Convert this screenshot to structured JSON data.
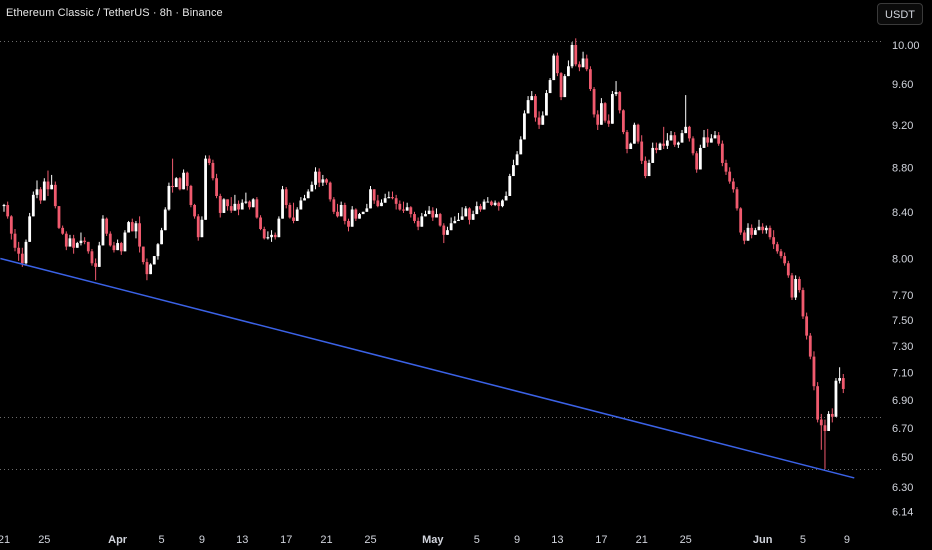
{
  "header": {
    "title": "Ethereum Classic / TetherUS · 8h · Binance",
    "currency_label": "USDT"
  },
  "colors": {
    "background": "#000000",
    "up": "#ffffff",
    "down": "#f05a6e",
    "trendline": "#3b62e6",
    "dotted_line": "#6b6b6b",
    "text": "#d1d4dc"
  },
  "chart_data": {
    "type": "candlestick",
    "y_scale": "log",
    "ylim": [
      6.08,
      10.1
    ],
    "y_ticks": [
      "10.00",
      "9.60",
      "9.20",
      "8.80",
      "8.40",
      "8.00",
      "7.70",
      "7.50",
      "7.30",
      "7.10",
      "6.90",
      "6.70",
      "6.50",
      "6.30",
      "6.14"
    ],
    "x_ticks": [
      {
        "label": "21",
        "idx": 0
      },
      {
        "label": "25",
        "idx": 11
      },
      {
        "label": "Apr",
        "idx": 31,
        "bold": true
      },
      {
        "label": "5",
        "idx": 43
      },
      {
        "label": "9",
        "idx": 54
      },
      {
        "label": "13",
        "idx": 65
      },
      {
        "label": "17",
        "idx": 77
      },
      {
        "label": "21",
        "idx": 88
      },
      {
        "label": "25",
        "idx": 100
      },
      {
        "label": "May",
        "idx": 117,
        "bold": true
      },
      {
        "label": "5",
        "idx": 129
      },
      {
        "label": "9",
        "idx": 140
      },
      {
        "label": "13",
        "idx": 151
      },
      {
        "label": "17",
        "idx": 163
      },
      {
        "label": "21",
        "idx": 174
      },
      {
        "label": "25",
        "idx": 186
      },
      {
        "label": "Jun",
        "idx": 207,
        "bold": true
      },
      {
        "label": "5",
        "idx": 218
      },
      {
        "label": "9",
        "idx": 230
      }
    ],
    "horizontal_levels": [
      10.04,
      6.78,
      6.42
    ],
    "trendline": {
      "start": [
        -1,
        8.0
      ],
      "end": [
        232,
        6.36
      ]
    },
    "candles": [
      [
        8.45,
        8.4,
        8.47,
        8.46
      ],
      [
        8.46,
        8.34,
        8.49,
        8.36
      ],
      [
        8.36,
        8.16,
        8.37,
        8.21
      ],
      [
        8.21,
        8.06,
        8.25,
        8.09
      ],
      [
        8.09,
        7.98,
        8.14,
        8.04
      ],
      [
        8.04,
        7.93,
        8.09,
        7.96
      ],
      [
        7.96,
        7.94,
        8.16,
        8.14
      ],
      [
        8.14,
        8.14,
        8.39,
        8.36
      ],
      [
        8.36,
        8.36,
        8.58,
        8.55
      ],
      [
        8.55,
        8.52,
        8.68,
        8.6
      ],
      [
        8.6,
        8.47,
        8.62,
        8.5
      ],
      [
        8.5,
        8.5,
        8.7,
        8.67
      ],
      [
        8.67,
        8.54,
        8.77,
        8.6
      ],
      [
        8.6,
        8.6,
        8.73,
        8.64
      ],
      [
        8.64,
        8.43,
        8.67,
        8.45
      ],
      [
        8.45,
        8.25,
        8.45,
        8.26
      ],
      [
        8.26,
        8.2,
        8.28,
        8.21
      ],
      [
        8.21,
        8.07,
        8.23,
        8.1
      ],
      [
        8.1,
        8.1,
        8.2,
        8.17
      ],
      [
        8.17,
        8.04,
        8.2,
        8.09
      ],
      [
        8.09,
        8.09,
        8.14,
        8.13
      ],
      [
        8.13,
        8.11,
        8.22,
        8.15
      ],
      [
        8.15,
        8.12,
        8.18,
        8.14
      ],
      [
        8.14,
        8.04,
        8.14,
        8.06
      ],
      [
        8.06,
        7.94,
        8.08,
        7.96
      ],
      [
        7.96,
        7.82,
        8.0,
        7.93
      ],
      [
        7.93,
        7.93,
        8.14,
        8.11
      ],
      [
        8.11,
        8.11,
        8.37,
        8.34
      ],
      [
        8.34,
        8.19,
        8.35,
        8.21
      ],
      [
        8.21,
        8.1,
        8.23,
        8.11
      ],
      [
        8.11,
        8.05,
        8.14,
        8.07
      ],
      [
        8.07,
        8.07,
        8.16,
        8.13
      ],
      [
        8.13,
        8.03,
        8.14,
        8.06
      ],
      [
        8.06,
        8.06,
        8.24,
        8.22
      ],
      [
        8.22,
        8.22,
        8.32,
        8.31
      ],
      [
        8.31,
        8.23,
        8.34,
        8.23
      ],
      [
        8.23,
        8.17,
        8.32,
        8.3
      ],
      [
        8.3,
        8.05,
        8.36,
        8.1
      ],
      [
        8.1,
        7.95,
        8.1,
        7.97
      ],
      [
        7.97,
        7.82,
        8.0,
        7.87
      ],
      [
        7.87,
        7.87,
        7.96,
        7.95
      ],
      [
        7.95,
        7.95,
        8.02,
        8.02
      ],
      [
        8.02,
        7.99,
        8.13,
        8.12
      ],
      [
        8.12,
        8.12,
        8.26,
        8.24
      ],
      [
        8.24,
        8.24,
        8.44,
        8.42
      ],
      [
        8.42,
        8.41,
        8.66,
        8.63
      ],
      [
        8.63,
        8.57,
        8.88,
        8.62
      ],
      [
        8.62,
        8.62,
        8.71,
        8.7
      ],
      [
        8.7,
        8.59,
        8.71,
        8.6
      ],
      [
        8.6,
        8.6,
        8.78,
        8.75
      ],
      [
        8.75,
        8.59,
        8.76,
        8.63
      ],
      [
        8.63,
        8.44,
        8.64,
        8.46
      ],
      [
        8.46,
        8.34,
        8.47,
        8.36
      ],
      [
        8.36,
        8.15,
        8.38,
        8.18
      ],
      [
        8.18,
        8.18,
        8.36,
        8.33
      ],
      [
        8.33,
        8.33,
        8.91,
        8.88
      ],
      [
        8.88,
        8.82,
        8.91,
        8.84
      ],
      [
        8.84,
        8.68,
        8.87,
        8.7
      ],
      [
        8.7,
        8.52,
        8.74,
        8.54
      ],
      [
        8.54,
        8.35,
        8.56,
        8.39
      ],
      [
        8.39,
        8.39,
        8.52,
        8.51
      ],
      [
        8.51,
        8.41,
        8.51,
        8.45
      ],
      [
        8.45,
        8.39,
        8.53,
        8.41
      ],
      [
        8.41,
        8.41,
        8.55,
        8.47
      ],
      [
        8.47,
        8.37,
        8.5,
        8.42
      ],
      [
        8.42,
        8.42,
        8.51,
        8.48
      ],
      [
        8.48,
        8.47,
        8.57,
        8.49
      ],
      [
        8.49,
        8.42,
        8.5,
        8.44
      ],
      [
        8.44,
        8.44,
        8.52,
        8.51
      ],
      [
        8.51,
        8.34,
        8.53,
        8.35
      ],
      [
        8.35,
        8.24,
        8.37,
        8.25
      ],
      [
        8.25,
        8.16,
        8.27,
        8.17
      ],
      [
        8.17,
        8.16,
        8.23,
        8.18
      ],
      [
        8.18,
        8.14,
        8.24,
        8.2
      ],
      [
        8.2,
        8.16,
        8.22,
        8.18
      ],
      [
        8.18,
        8.18,
        8.36,
        8.34
      ],
      [
        8.34,
        8.34,
        8.63,
        8.6
      ],
      [
        8.6,
        8.43,
        8.62,
        8.46
      ],
      [
        8.46,
        8.34,
        8.48,
        8.35
      ],
      [
        8.35,
        8.3,
        8.48,
        8.32
      ],
      [
        8.32,
        8.32,
        8.44,
        8.42
      ],
      [
        8.42,
        8.42,
        8.53,
        8.5
      ],
      [
        8.5,
        8.5,
        8.55,
        8.52
      ],
      [
        8.52,
        8.52,
        8.6,
        8.58
      ],
      [
        8.58,
        8.58,
        8.67,
        8.64
      ],
      [
        8.64,
        8.6,
        8.8,
        8.76
      ],
      [
        8.76,
        8.62,
        8.79,
        8.66
      ],
      [
        8.66,
        8.63,
        8.73,
        8.69
      ],
      [
        8.69,
        8.64,
        8.7,
        8.66
      ],
      [
        8.66,
        8.49,
        8.67,
        8.51
      ],
      [
        8.51,
        8.38,
        8.53,
        8.4
      ],
      [
        8.4,
        8.35,
        8.47,
        8.36
      ],
      [
        8.36,
        8.36,
        8.49,
        8.46
      ],
      [
        8.46,
        8.29,
        8.48,
        8.32
      ],
      [
        8.32,
        8.23,
        8.34,
        8.27
      ],
      [
        8.27,
        8.27,
        8.45,
        8.42
      ],
      [
        8.42,
        8.32,
        8.43,
        8.34
      ],
      [
        8.34,
        8.34,
        8.39,
        8.38
      ],
      [
        8.38,
        8.38,
        8.4,
        8.4
      ],
      [
        8.4,
        8.4,
        8.47,
        8.43
      ],
      [
        8.43,
        8.43,
        8.63,
        8.6
      ],
      [
        8.6,
        8.47,
        8.6,
        8.5
      ],
      [
        8.5,
        8.44,
        8.55,
        8.45
      ],
      [
        8.45,
        8.45,
        8.51,
        8.48
      ],
      [
        8.48,
        8.48,
        8.56,
        8.52
      ],
      [
        8.52,
        8.52,
        8.58,
        8.53
      ],
      [
        8.53,
        8.51,
        8.58,
        8.52
      ],
      [
        8.52,
        8.42,
        8.55,
        8.47
      ],
      [
        8.47,
        8.41,
        8.5,
        8.42
      ],
      [
        8.42,
        8.39,
        8.49,
        8.41
      ],
      [
        8.41,
        8.41,
        8.48,
        8.44
      ],
      [
        8.44,
        8.35,
        8.45,
        8.38
      ],
      [
        8.38,
        8.3,
        8.4,
        8.32
      ],
      [
        8.32,
        8.24,
        8.35,
        8.27
      ],
      [
        8.27,
        8.27,
        8.39,
        8.36
      ],
      [
        8.36,
        8.36,
        8.41,
        8.38
      ],
      [
        8.38,
        8.38,
        8.45,
        8.41
      ],
      [
        8.41,
        8.32,
        8.44,
        8.35
      ],
      [
        8.35,
        8.35,
        8.43,
        8.38
      ],
      [
        8.38,
        8.27,
        8.39,
        8.28
      ],
      [
        8.28,
        8.13,
        8.3,
        8.2
      ],
      [
        8.2,
        8.2,
        8.27,
        8.24
      ],
      [
        8.24,
        8.24,
        8.35,
        8.3
      ],
      [
        8.3,
        8.3,
        8.36,
        8.32
      ],
      [
        8.32,
        8.32,
        8.39,
        8.33
      ],
      [
        8.33,
        8.33,
        8.44,
        8.36
      ],
      [
        8.36,
        8.36,
        8.45,
        8.43
      ],
      [
        8.43,
        8.29,
        8.44,
        8.33
      ],
      [
        8.33,
        8.33,
        8.41,
        8.38
      ],
      [
        8.38,
        8.38,
        8.49,
        8.45
      ],
      [
        8.45,
        8.4,
        8.47,
        8.42
      ],
      [
        8.42,
        8.42,
        8.51,
        8.49
      ],
      [
        8.49,
        8.49,
        8.53,
        8.49
      ],
      [
        8.49,
        8.45,
        8.5,
        8.46
      ],
      [
        8.46,
        8.45,
        8.5,
        8.48
      ],
      [
        8.48,
        8.41,
        8.49,
        8.45
      ],
      [
        8.45,
        8.44,
        8.51,
        8.5
      ],
      [
        8.5,
        8.5,
        8.58,
        8.54
      ],
      [
        8.54,
        8.54,
        8.74,
        8.72
      ],
      [
        8.72,
        8.72,
        8.87,
        8.82
      ],
      [
        8.82,
        8.82,
        8.95,
        8.92
      ],
      [
        8.92,
        8.92,
        9.09,
        9.06
      ],
      [
        9.06,
        9.06,
        9.34,
        9.31
      ],
      [
        9.31,
        9.31,
        9.48,
        9.44
      ],
      [
        9.44,
        9.44,
        9.53,
        9.48
      ],
      [
        9.48,
        9.23,
        9.5,
        9.27
      ],
      [
        9.27,
        9.16,
        9.33,
        9.2
      ],
      [
        9.2,
        9.2,
        9.33,
        9.29
      ],
      [
        9.29,
        9.29,
        9.54,
        9.51
      ],
      [
        9.51,
        9.51,
        9.66,
        9.64
      ],
      [
        9.64,
        9.64,
        9.91,
        9.89
      ],
      [
        9.89,
        9.68,
        9.92,
        9.71
      ],
      [
        9.71,
        9.44,
        9.72,
        9.47
      ],
      [
        9.47,
        9.47,
        9.7,
        9.68
      ],
      [
        9.68,
        9.68,
        9.84,
        9.78
      ],
      [
        9.78,
        9.76,
        10.03,
        10.0
      ],
      [
        10.0,
        9.78,
        10.07,
        9.8
      ],
      [
        9.8,
        9.73,
        9.83,
        9.77
      ],
      [
        9.77,
        9.77,
        9.93,
        9.86
      ],
      [
        9.86,
        9.73,
        9.9,
        9.75
      ],
      [
        9.75,
        9.53,
        9.78,
        9.55
      ],
      [
        9.55,
        9.27,
        9.57,
        9.3
      ],
      [
        9.3,
        9.15,
        9.34,
        9.2
      ],
      [
        9.2,
        9.2,
        9.46,
        9.41
      ],
      [
        9.41,
        9.22,
        9.42,
        9.24
      ],
      [
        9.24,
        9.18,
        9.3,
        9.21
      ],
      [
        9.21,
        9.21,
        9.53,
        9.5
      ],
      [
        9.5,
        9.48,
        9.63,
        9.52
      ],
      [
        9.52,
        9.31,
        9.53,
        9.34
      ],
      [
        9.34,
        9.11,
        9.35,
        9.13
      ],
      [
        9.13,
        8.93,
        9.15,
        8.97
      ],
      [
        8.97,
        8.97,
        9.03,
        9.02
      ],
      [
        9.02,
        9.02,
        9.22,
        9.2
      ],
      [
        9.2,
        9.02,
        9.21,
        9.04
      ],
      [
        9.04,
        8.83,
        9.1,
        8.86
      ],
      [
        8.86,
        8.7,
        8.9,
        8.72
      ],
      [
        8.72,
        8.72,
        8.87,
        8.84
      ],
      [
        8.84,
        8.84,
        9.03,
        8.98
      ],
      [
        8.98,
        8.93,
        9.03,
        8.96
      ],
      [
        8.96,
        8.96,
        9.03,
        9.02
      ],
      [
        9.02,
        8.97,
        9.18,
        9.0
      ],
      [
        9.0,
        8.97,
        9.12,
        9.05
      ],
      [
        9.05,
        9.05,
        9.14,
        9.1
      ],
      [
        9.1,
        8.99,
        9.13,
        9.01
      ],
      [
        9.01,
        8.98,
        9.04,
        9.03
      ],
      [
        9.03,
        9.03,
        9.15,
        9.12
      ],
      [
        9.12,
        9.12,
        9.49,
        9.18
      ],
      [
        9.18,
        9.04,
        9.19,
        9.07
      ],
      [
        9.07,
        8.91,
        9.09,
        8.93
      ],
      [
        8.93,
        8.75,
        8.95,
        8.78
      ],
      [
        8.78,
        8.78,
        9.01,
        8.98
      ],
      [
        8.98,
        8.98,
        9.15,
        9.08
      ],
      [
        9.08,
        8.99,
        9.16,
        9.03
      ],
      [
        9.03,
        9.03,
        9.11,
        9.07
      ],
      [
        9.07,
        9.07,
        9.14,
        9.1
      ],
      [
        9.1,
        9.0,
        9.13,
        9.02
      ],
      [
        9.02,
        8.81,
        9.05,
        8.84
      ],
      [
        8.84,
        8.73,
        8.87,
        8.76
      ],
      [
        8.76,
        8.65,
        8.8,
        8.67
      ],
      [
        8.67,
        8.57,
        8.7,
        8.6
      ],
      [
        8.6,
        8.41,
        8.62,
        8.43
      ],
      [
        8.43,
        8.2,
        8.44,
        8.22
      ],
      [
        8.22,
        8.12,
        8.24,
        8.15
      ],
      [
        8.15,
        8.15,
        8.3,
        8.26
      ],
      [
        8.26,
        8.17,
        8.29,
        8.2
      ],
      [
        8.2,
        8.2,
        8.26,
        8.24
      ],
      [
        8.24,
        8.24,
        8.33,
        8.27
      ],
      [
        8.27,
        8.21,
        8.3,
        8.24
      ],
      [
        8.24,
        8.21,
        8.28,
        8.26
      ],
      [
        8.26,
        8.16,
        8.28,
        8.18
      ],
      [
        8.18,
        8.08,
        8.24,
        8.12
      ],
      [
        8.12,
        8.04,
        8.14,
        8.06
      ],
      [
        8.06,
        8.0,
        8.08,
        8.02
      ],
      [
        8.02,
        7.94,
        8.05,
        7.96
      ],
      [
        7.96,
        7.84,
        7.98,
        7.86
      ],
      [
        7.86,
        7.66,
        7.88,
        7.68
      ],
      [
        7.68,
        7.66,
        7.86,
        7.83
      ],
      [
        7.83,
        7.72,
        7.85,
        7.74
      ],
      [
        7.74,
        7.51,
        7.76,
        7.53
      ],
      [
        7.53,
        7.35,
        7.56,
        7.38
      ],
      [
        7.38,
        7.2,
        7.4,
        7.22
      ],
      [
        7.22,
        6.97,
        7.26,
        7.0
      ],
      [
        7.0,
        6.74,
        7.03,
        6.76
      ],
      [
        6.76,
        6.55,
        6.8,
        6.72
      ],
      [
        6.72,
        6.42,
        6.76,
        6.68
      ],
      [
        6.68,
        6.68,
        6.82,
        6.8
      ],
      [
        6.8,
        6.74,
        6.84,
        6.78
      ],
      [
        6.78,
        6.78,
        7.06,
        7.04
      ],
      [
        7.04,
        7.02,
        7.14,
        7.06
      ],
      [
        7.06,
        6.95,
        7.09,
        6.98
      ]
    ]
  }
}
